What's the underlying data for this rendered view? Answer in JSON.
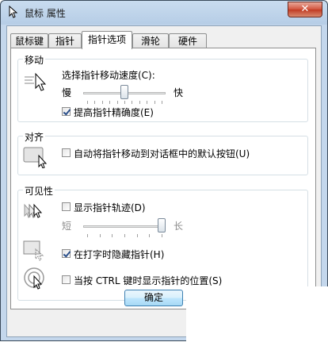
{
  "window": {
    "title": "鼠标 属性",
    "close_glyph": "✕"
  },
  "tabs": [
    {
      "label": "鼠标键"
    },
    {
      "label": "指针"
    },
    {
      "label": "指针选项"
    },
    {
      "label": "滑轮"
    },
    {
      "label": "硬件"
    }
  ],
  "active_tab": "指针选项",
  "motion": {
    "title": "移动",
    "speed_label": "选择指针移动速度(C):",
    "slow_label": "慢",
    "fast_label": "快",
    "speed_level": 0.5,
    "precision_label": "提高指针精确度(E)",
    "precision_checked": true
  },
  "snap": {
    "title": "对齐",
    "snap_label": "自动将指针移动到对话框中的默认按钮(U)",
    "snap_checked": false
  },
  "visibility": {
    "title": "可见性",
    "trails_label": "显示指针轨迹(D)",
    "trails_checked": false,
    "short_label": "短",
    "long_label": "长",
    "trails_level": 1.0,
    "hide_label": "在打字时隐藏指针(H)",
    "hide_checked": true,
    "ctrl_label": "当按 CTRL 键时显示指针的位置(S)",
    "ctrl_checked": false
  },
  "buttons": {
    "ok_label": "确定"
  },
  "colors": {
    "accent": "#3c7fb1",
    "titlebar": "#b6cde6",
    "close": "#c03a22"
  }
}
